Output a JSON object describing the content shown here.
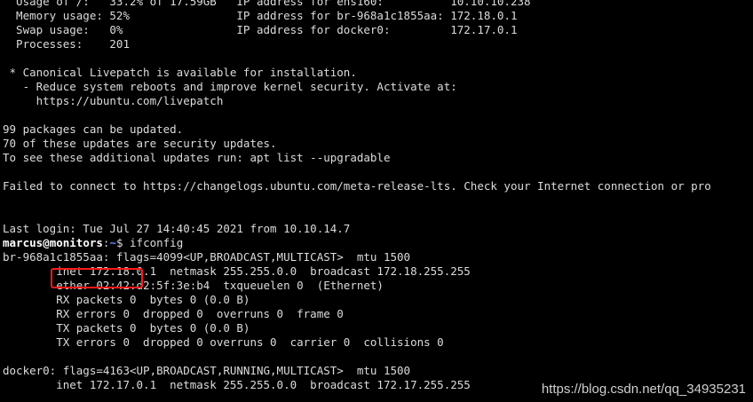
{
  "colors": {
    "background": "#000000",
    "text": "#dcdcdc",
    "prompt_path": "#5f87ff",
    "highlight_border": "#ff1a1a"
  },
  "system_info": [
    "  Usage of /:   33.2% of 17.59GB   IP address for ens160:          10.10.10.238",
    "  Memory usage: 52%                IP address for br-968a1c1855aa: 172.18.0.1",
    "  Swap usage:   0%                 IP address for docker0:         172.17.0.1",
    "  Processes:    201"
  ],
  "livepatch": [
    " * Canonical Livepatch is available for installation.",
    "   - Reduce system reboots and improve kernel security. Activate at:",
    "     https://ubuntu.com/livepatch"
  ],
  "updates": [
    "99 packages can be updated.",
    "70 of these updates are security updates.",
    "To see these additional updates run: apt list --upgradable"
  ],
  "release_check": "Failed to connect to https://changelogs.ubuntu.com/meta-release-lts. Check your Internet connection or pro",
  "last_login": "Last login: Tue Jul 27 14:40:45 2021 from 10.10.14.7",
  "prompt": {
    "user": "marcus",
    "at": "@",
    "host": "monitors",
    "colon": ":",
    "path": "~",
    "symbol": "$ ",
    "command": "ifconfig"
  },
  "ifconfig_br": [
    "br-968a1c1855aa: flags=4099<UP,BROADCAST,MULTICAST>  mtu 1500",
    "        inet 172.18.0.1  netmask 255.255.0.0  broadcast 172.18.255.255",
    "        ether 02:42:d2:5f:3e:b4  txqueuelen 0  (Ethernet)",
    "        RX packets 0  bytes 0 (0.0 B)",
    "        RX errors 0  dropped 0  overruns 0  frame 0",
    "        TX packets 0  bytes 0 (0.0 B)",
    "        TX errors 0  dropped 0 overruns 0  carrier 0  collisions 0"
  ],
  "ifconfig_docker": [
    "docker0: flags=4163<UP,BROADCAST,RUNNING,MULTICAST>  mtu 1500",
    "        inet 172.17.0.1  netmask 255.255.0.0  broadcast 172.17.255.255"
  ],
  "watermark": "https://blog.csdn.net/qq_34935231"
}
